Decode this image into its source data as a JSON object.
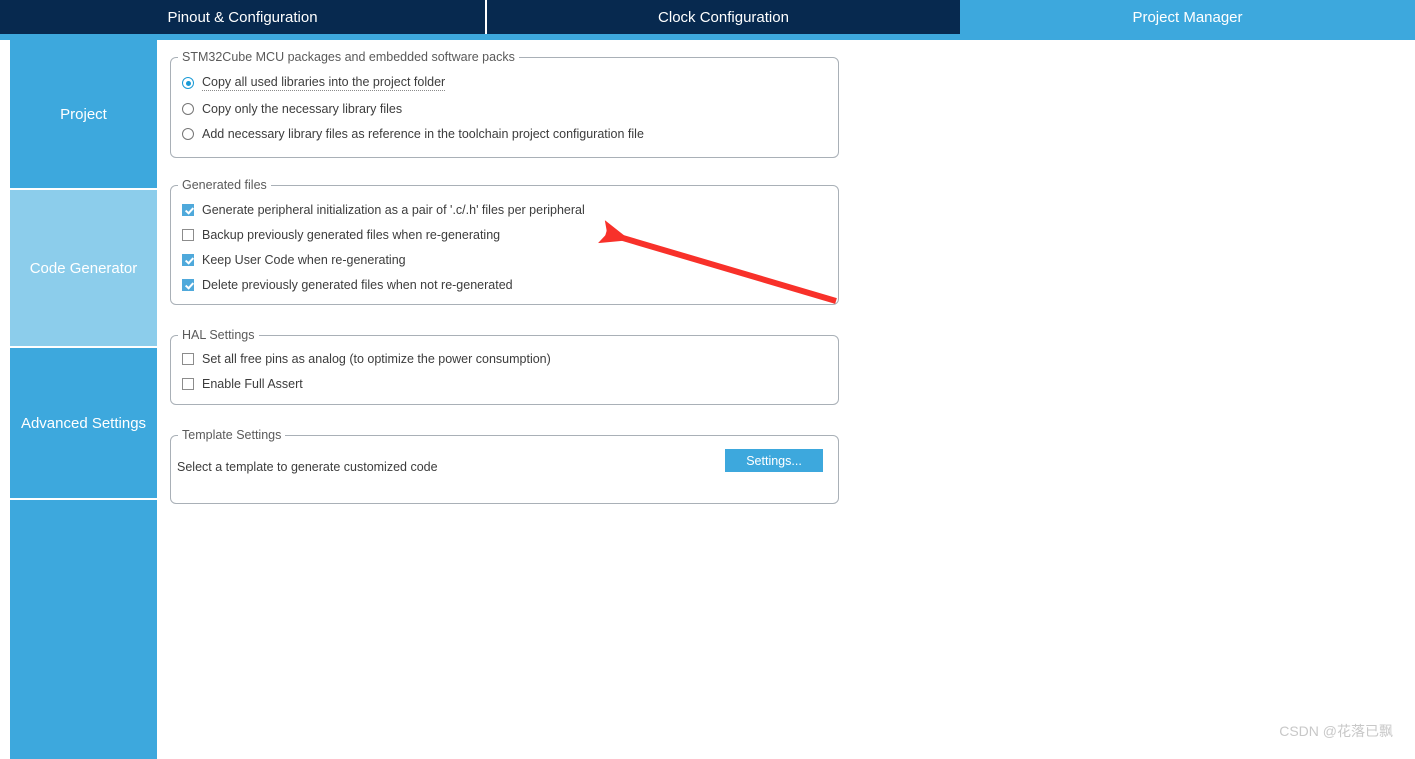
{
  "app": {
    "watermark": "CSDN @花落已飘",
    "accent_color": "#3da8dd",
    "tabbar_color": "#07294f",
    "active_side_color": "#8ccdeb",
    "annotation_color": "#f8312a"
  },
  "tabs": [
    {
      "label": "Pinout & Configuration",
      "active": false
    },
    {
      "label": "Clock Configuration",
      "active": false
    },
    {
      "label": "Project Manager",
      "active": true
    }
  ],
  "sidebar": {
    "items": [
      {
        "label": "Project",
        "active": false
      },
      {
        "label": "Code Generator",
        "active": true
      },
      {
        "label": "Advanced Settings",
        "active": false
      },
      {
        "label": "",
        "active": false
      }
    ]
  },
  "groups": {
    "packages": {
      "legend": "STM32Cube MCU packages and embedded software packs",
      "options": [
        {
          "label": "Copy all used libraries into the project folder",
          "selected": true,
          "focused": true
        },
        {
          "label": "Copy only the necessary library files",
          "selected": false,
          "focused": false
        },
        {
          "label": "Add necessary library files as reference in the toolchain project configuration file",
          "selected": false,
          "focused": false
        }
      ]
    },
    "generated_files": {
      "legend": "Generated files",
      "options": [
        {
          "label": "Generate peripheral initialization as a pair of '.c/.h' files per peripheral",
          "checked": true
        },
        {
          "label": "Backup previously generated files when re-generating",
          "checked": false
        },
        {
          "label": "Keep User Code when re-generating",
          "checked": true
        },
        {
          "label": "Delete previously generated files when not re-generated",
          "checked": true
        }
      ]
    },
    "hal_settings": {
      "legend": "HAL Settings",
      "options": [
        {
          "label": "Set all free pins as analog (to optimize the power consumption)",
          "checked": false
        },
        {
          "label": "Enable Full Assert",
          "checked": false
        }
      ]
    },
    "template_settings": {
      "legend": "Template Settings",
      "description": "Select a template to generate customized code",
      "settings_button": "Settings..."
    }
  }
}
